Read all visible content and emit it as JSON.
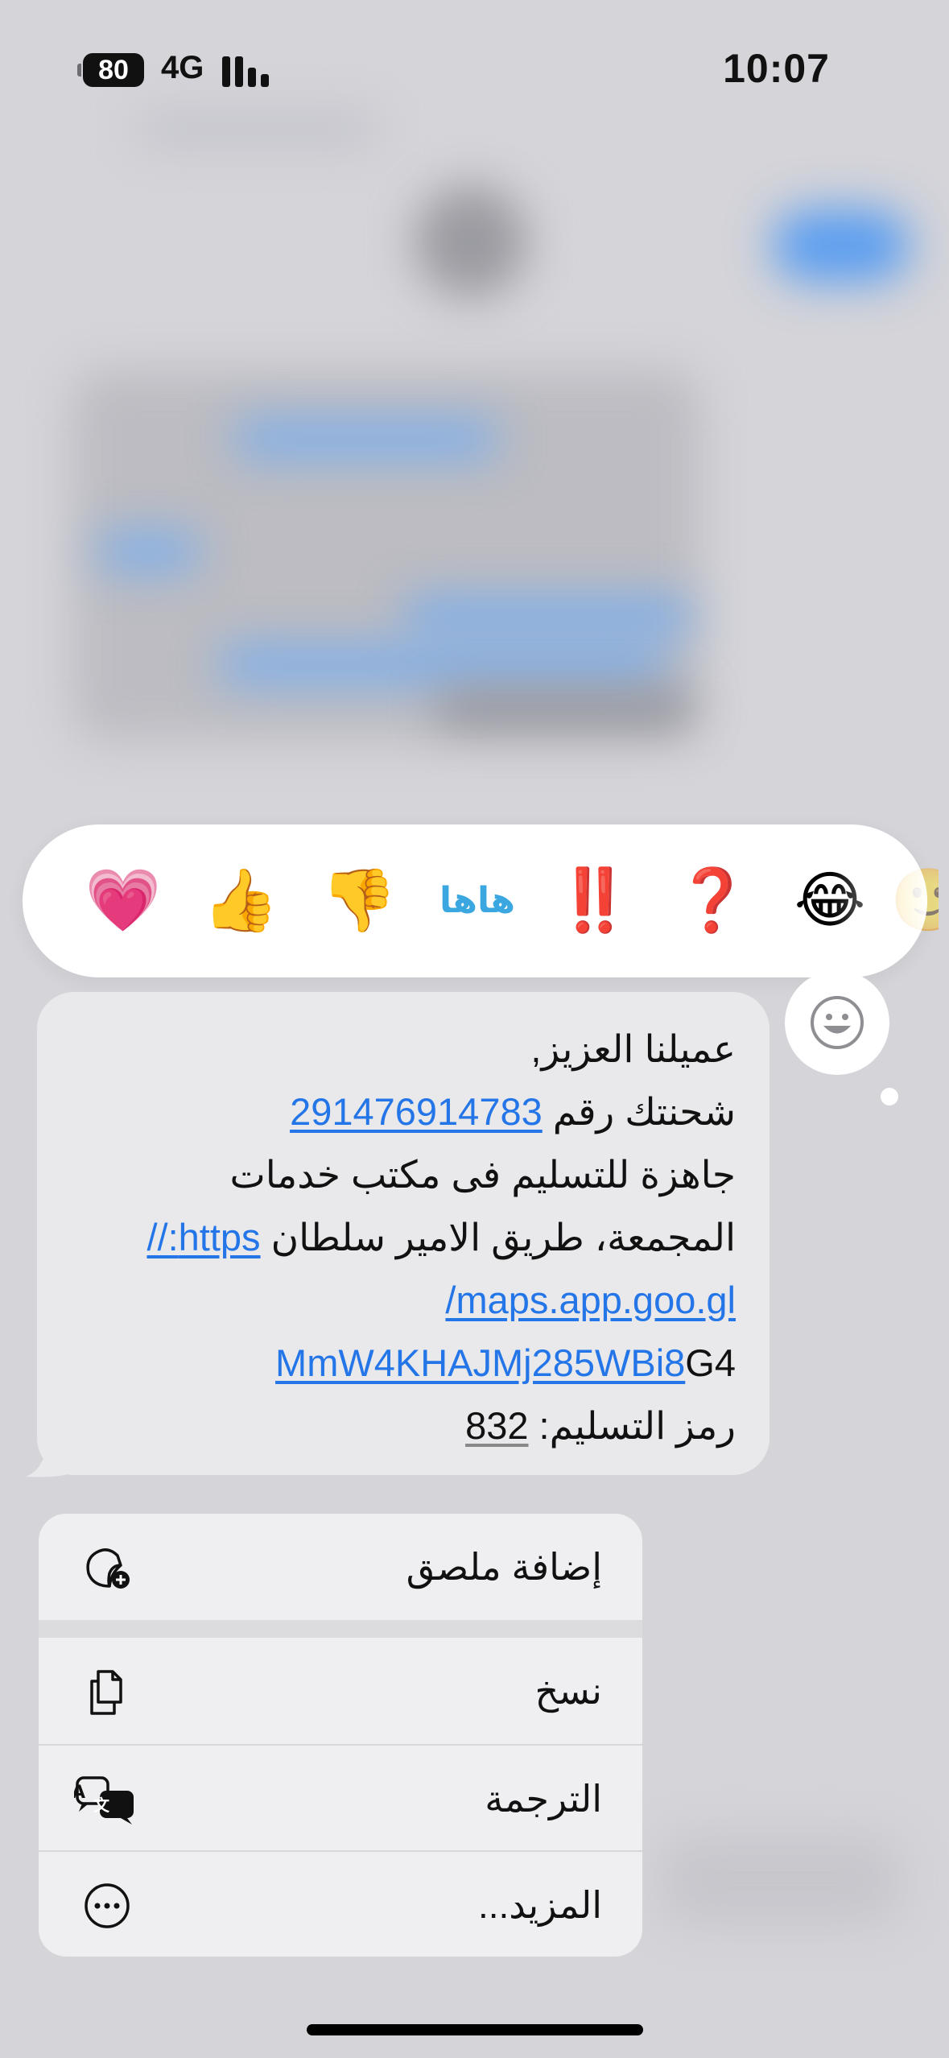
{
  "status_bar": {
    "battery": "80",
    "network": "4G",
    "time": "10:07"
  },
  "reactions": [
    {
      "name": "heart",
      "glyph": "💗"
    },
    {
      "name": "thumbs-up",
      "glyph": "👍"
    },
    {
      "name": "thumbs-down",
      "glyph": "👎"
    },
    {
      "name": "haha",
      "glyph": "هاها"
    },
    {
      "name": "exclamation",
      "glyph": "‼️"
    },
    {
      "name": "question",
      "glyph": "❓"
    },
    {
      "name": "laughing",
      "glyph": "😂"
    }
  ],
  "message": {
    "line1": "عميلنا العزيز,",
    "line2_text": "شحنتك رقم ",
    "line2_link": "291476914783",
    "line3": "جاهزة للتسليم فى مكتب خدمات",
    "line4_text": "المجمعة، طريق الامير سلطان ",
    "line4_link": "https://",
    "line5_link": "maps.app.goo.gl/",
    "line6_link": "MmW4KHAJMj285WBi8",
    "line6_text": " G4",
    "line7_text": "رمز التسليم: ",
    "line7_code": "832"
  },
  "menu": {
    "add_sticker": "إضافة ملصق",
    "copy": "نسخ",
    "translate": "الترجمة",
    "more": "المزيد..."
  },
  "colors": {
    "link": "#2476e8",
    "bubble": "#e9e9eb",
    "reaction_accent_blue": "#3ba7e0"
  }
}
